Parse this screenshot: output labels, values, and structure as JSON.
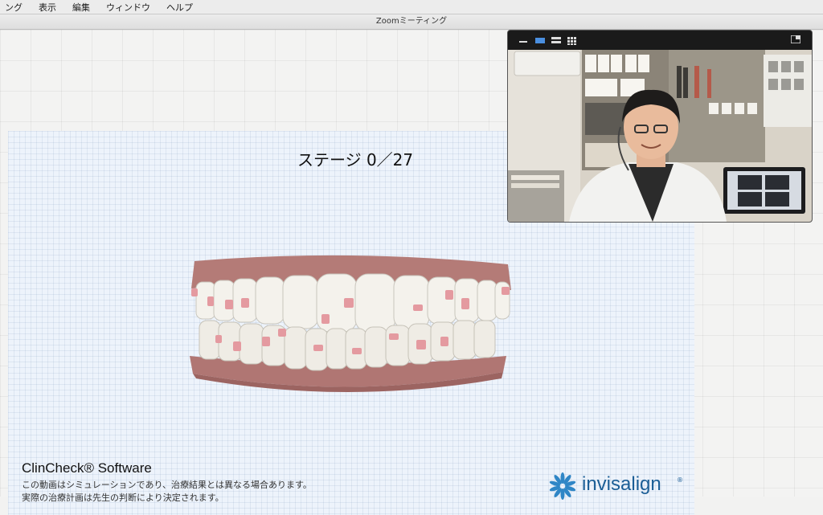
{
  "menubar": {
    "items": [
      "ング",
      "表示",
      "編集",
      "ウィンドウ",
      "ヘルプ"
    ]
  },
  "window": {
    "title": "Zoomミーティング"
  },
  "presentation": {
    "stage_label": "ステージ 0／27",
    "software_title": "ClinCheck® Software",
    "disclaimer_line1": "この動画はシミュレーションであり、治療結果とは異なる場合あります。",
    "disclaimer_line2": "実際の治療計画は先生の判断により決定されます。",
    "brand_logo_text": "invisalign",
    "brand_logo_mark": "®"
  },
  "video_panel": {
    "toolbar_icons": [
      "minimize-icon",
      "speaker-view-icon",
      "strip-view-icon",
      "gallery-view-icon",
      "exit-fullscreen-icon"
    ],
    "participant": "presenter-video-feed"
  },
  "colors": {
    "accent": "#1b5e96",
    "gum": "#b17a76",
    "attachment": "#e8a4a8"
  }
}
